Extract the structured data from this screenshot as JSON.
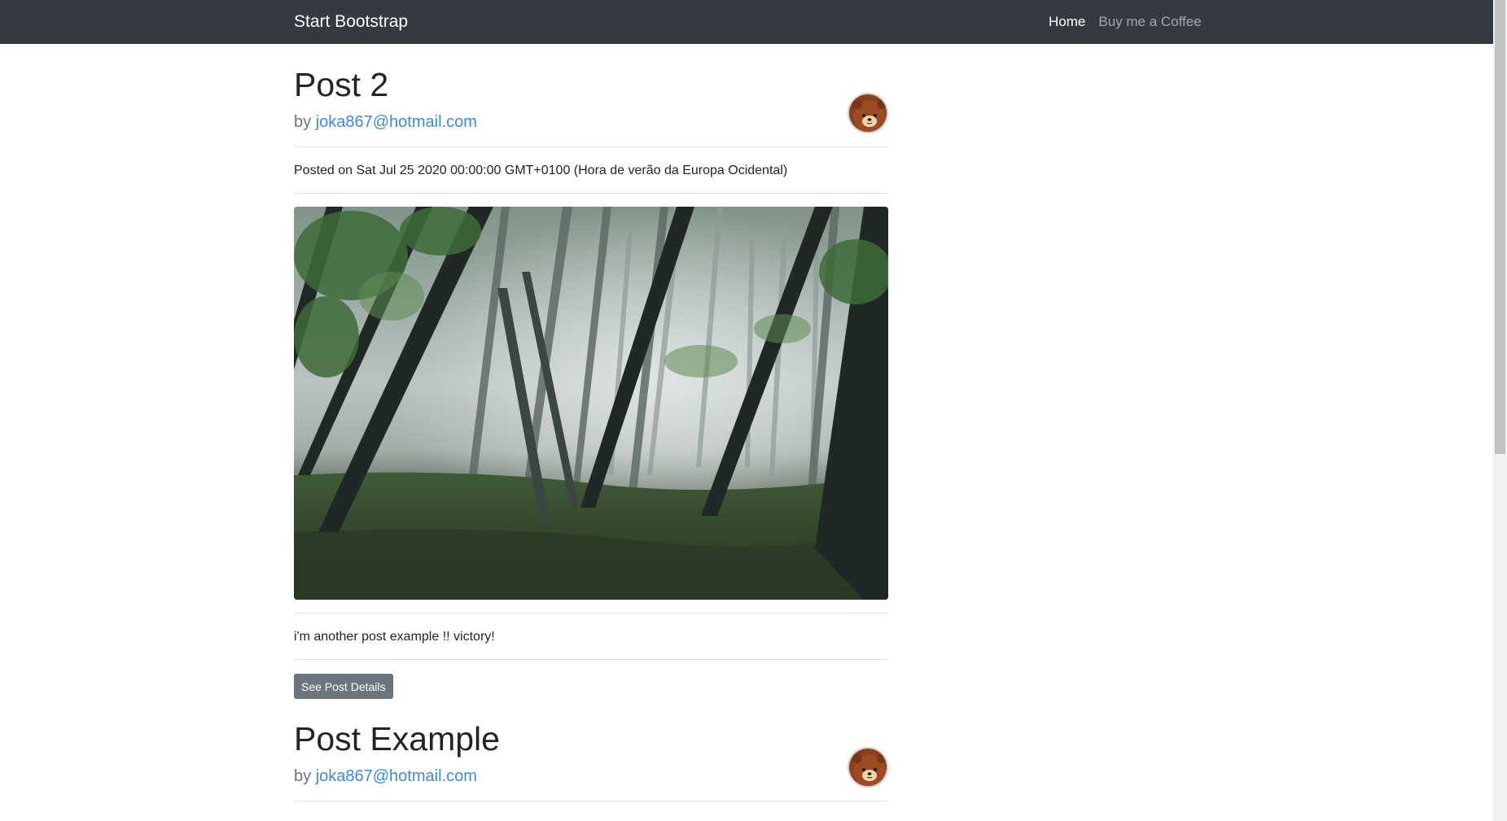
{
  "navbar": {
    "brand": "Start Bootstrap",
    "links": [
      {
        "label": "Home"
      },
      {
        "label": "Buy me a Coffee"
      }
    ]
  },
  "posts": [
    {
      "title": "Post 2",
      "by_prefix": "by ",
      "author": "joka867@hotmail.com",
      "posted_on": "Posted on Sat Jul 25 2020 00:00:00 GMT+0100 (Hora de verão da Europa Ocidental)",
      "body": "i'm another post example !! victory!",
      "button": "See Post Details"
    },
    {
      "title": "Post Example",
      "by_prefix": "by ",
      "author": "joka867@hotmail.com"
    }
  ],
  "colors": {
    "navbar_bg": "#343a40",
    "link": "#3a8ae6",
    "button_bg": "#6c757d"
  }
}
